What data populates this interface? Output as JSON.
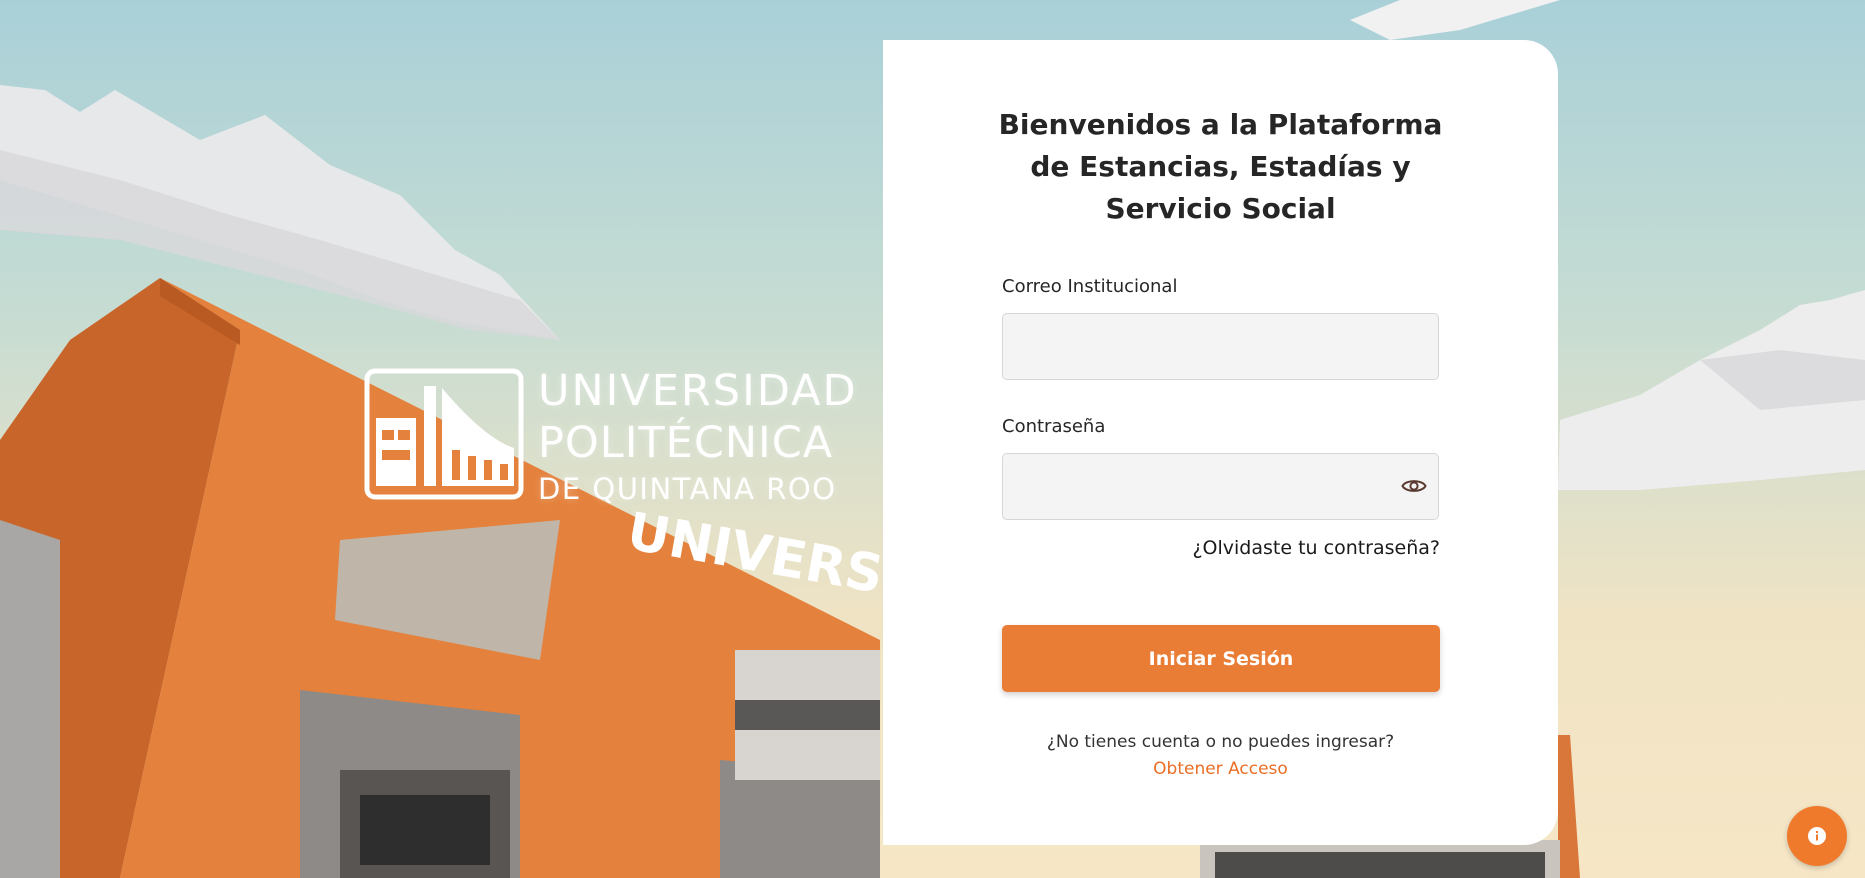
{
  "background": {
    "building_sign_text": "UNIVERSIDAD"
  },
  "logo": {
    "line1": "UNIVERSIDAD",
    "line2": "POLITÉCNICA",
    "line3": "DE QUINTANA ROO"
  },
  "login": {
    "title": "Bienvenidos a la Plataforma de Estancias, Estadías y Servicio Social",
    "email_label": "Correo Institucional",
    "email_value": "",
    "password_label": "Contraseña",
    "password_value": "",
    "password_toggle_icon": "eye-icon",
    "forgot_link": "¿Olvidaste tu contraseña?",
    "submit_label": "Iniciar Sesión",
    "no_account_text": "¿No tienes cuenta o no puedes ingresar?",
    "get_access_link": "Obtener Acceso"
  },
  "info_button": {
    "icon": "info-icon"
  },
  "colors": {
    "accent": "#ea7d36",
    "link_accent": "#ea6f25",
    "card_bg": "#ffffff",
    "input_bg": "#f4f4f4"
  }
}
